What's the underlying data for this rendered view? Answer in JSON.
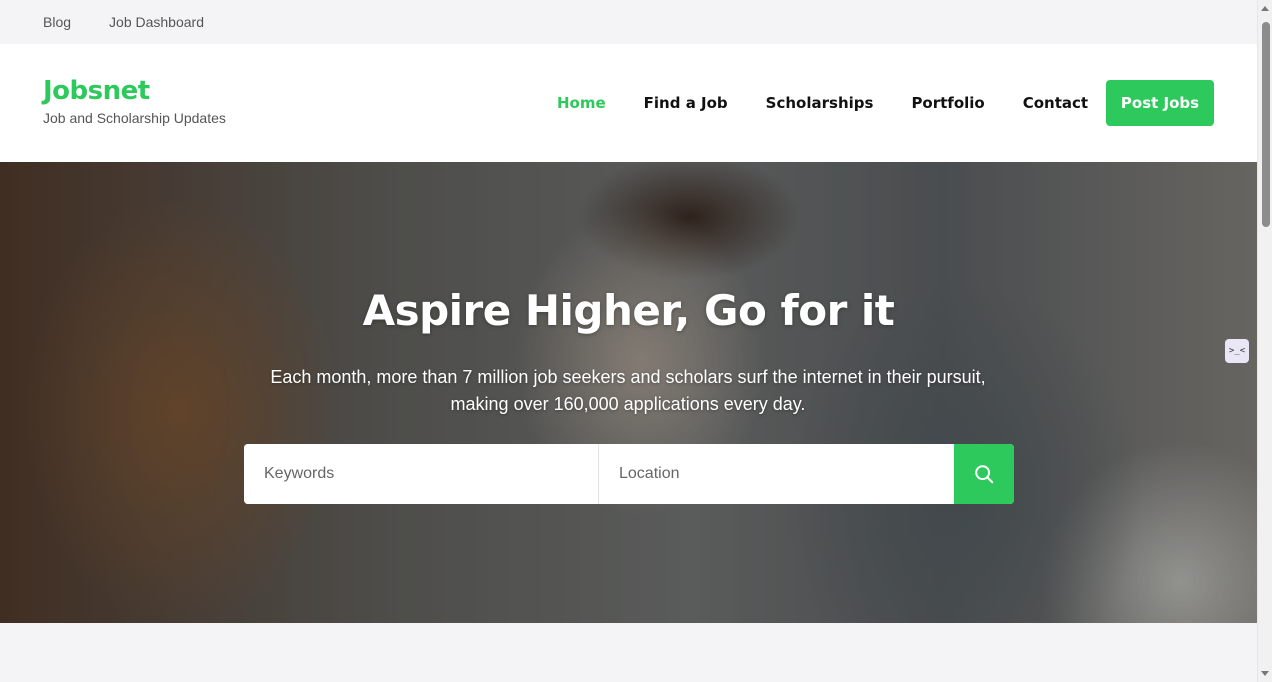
{
  "topbar": {
    "links": [
      "Blog",
      "Job Dashboard"
    ]
  },
  "brand": {
    "name": "Jobsnet",
    "tagline": "Job and Scholarship Updates",
    "accent_color": "#2ec95c"
  },
  "nav": {
    "items": [
      "Home",
      "Find a Job",
      "Scholarships",
      "Portfolio",
      "Contact"
    ],
    "active": "Home",
    "cta_label": "Post Jobs"
  },
  "hero": {
    "title": "Aspire Higher, Go for it",
    "subtitle_line1": "Each month, more than 7 million job seekers and scholars surf the internet in their pursuit,",
    "subtitle_line2": "making over 160,000 applications every day."
  },
  "search": {
    "keywords_placeholder": "Keywords",
    "location_placeholder": "Location",
    "button_icon": "search-icon"
  },
  "widget": {
    "glyph": ">_<"
  }
}
